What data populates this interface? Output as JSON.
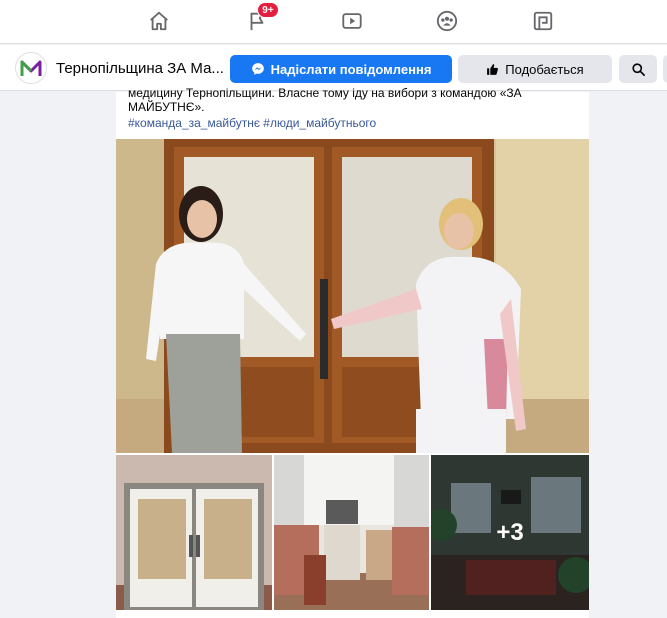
{
  "topnav": {
    "icons": [
      "home-icon",
      "flag-icon",
      "video-icon",
      "groups-icon",
      "gaming-icon"
    ],
    "notification_badge": "9+"
  },
  "page_header": {
    "name": "Тернопільщина ЗА Ма...",
    "message_button": "Надіслати повідомлення",
    "like_button": "Подобається"
  },
  "post": {
    "text": "медицину Тернопільщини. Власне тому іду на вибори з командою «ЗА МАЙБУТНЄ».",
    "hashtags": "#команда_за_майбутнє #люди_майбутнього",
    "more_photos": "+3"
  },
  "colors": {
    "brand_blue": "#1877f2",
    "badge_red": "#e41e3f",
    "link": "#385898"
  }
}
